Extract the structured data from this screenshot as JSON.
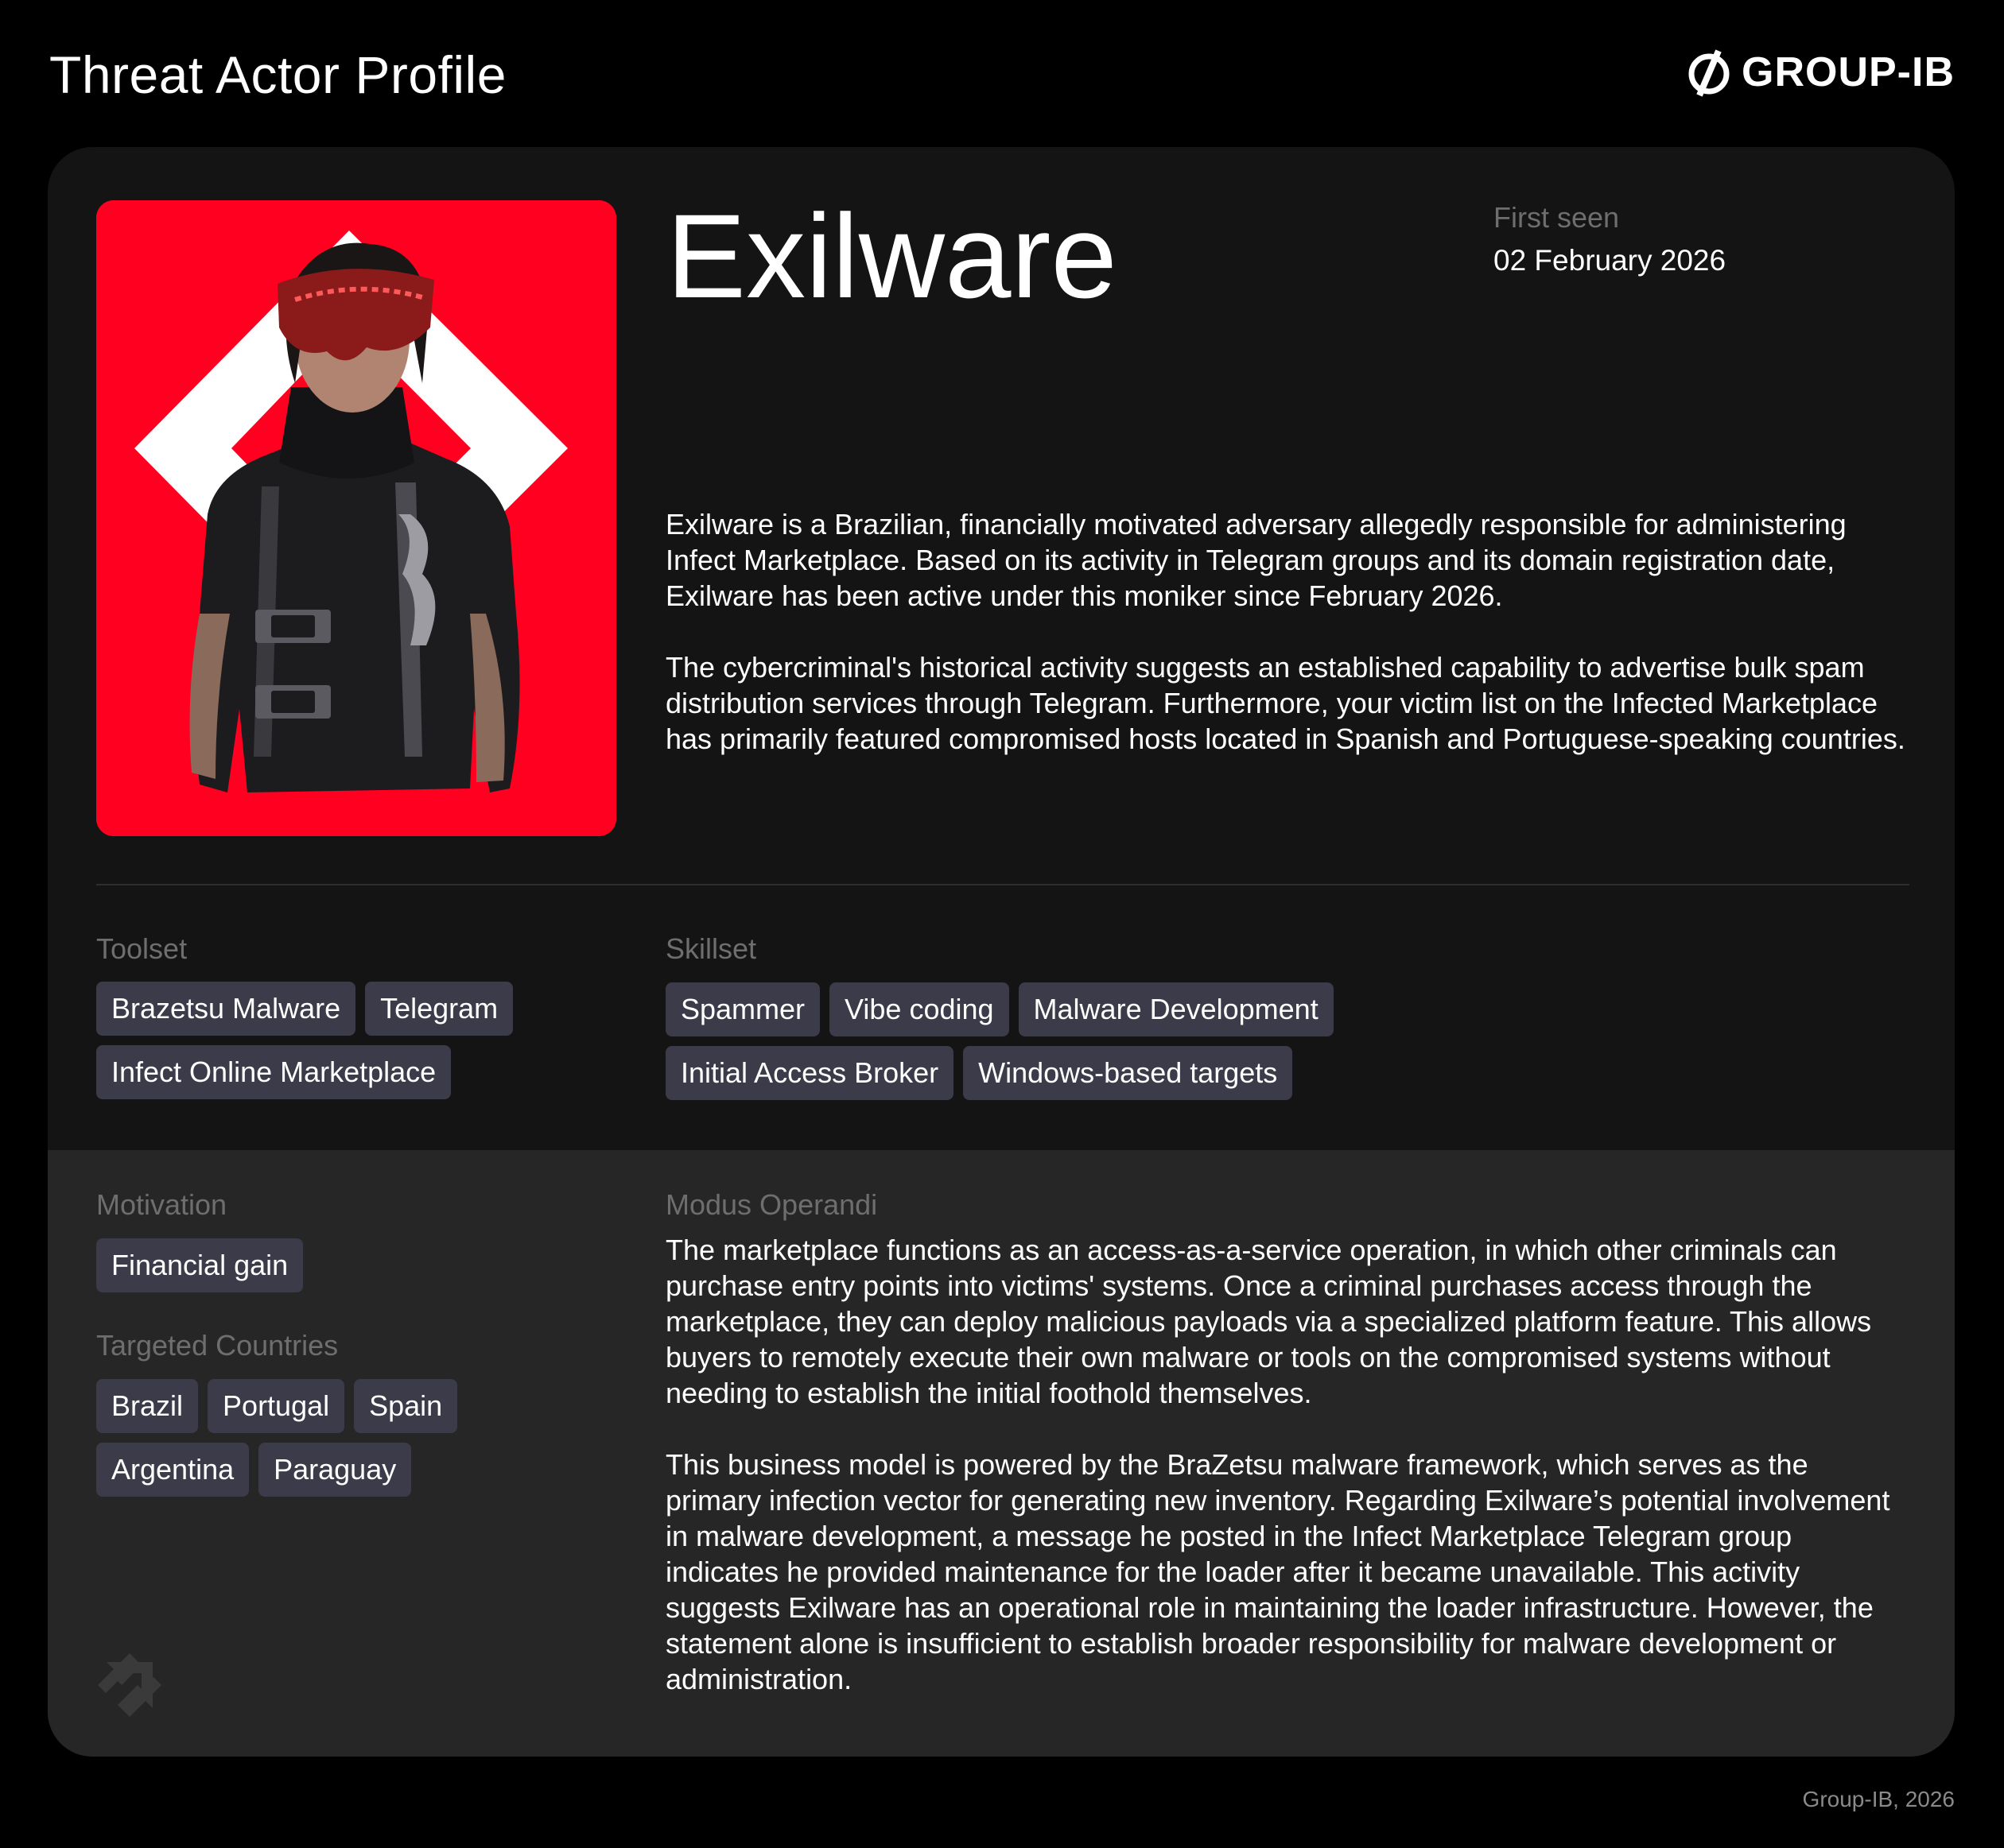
{
  "header": {
    "title": "Threat Actor Profile",
    "brand": "GROUP-IB"
  },
  "profile": {
    "name": "Exilware",
    "first_seen_label": "First seen",
    "first_seen_date": "02 February 2026",
    "description": [
      "Exilware is a Brazilian, financially motivated adversary allegedly responsible for administering Infect Marketplace. Based on its activity in Telegram groups and its domain registration date, Exilware has been active under this moniker since February 2026.",
      "The cybercriminal's historical activity suggests an established capability to advertise bulk spam distribution services through Telegram. Furthermore, your victim list on the Infected Marketplace has primarily featured compromised hosts located in Spanish and Portuguese-speaking countries."
    ]
  },
  "toolset": {
    "label": "Toolset",
    "items": [
      "Brazetsu Malware",
      "Telegram",
      "Infect Online Marketplace"
    ]
  },
  "skillset": {
    "label": "Skillset",
    "items": [
      "Spammer",
      "Vibe coding",
      "Malware Development",
      "Initial Access Broker",
      "Windows-based targets"
    ]
  },
  "motivation": {
    "label": "Motivation",
    "items": [
      "Financial gain"
    ]
  },
  "targeted_countries": {
    "label": "Targeted Countries",
    "items": [
      "Brazil",
      "Portugal",
      "Spain",
      "Argentina",
      "Paraguay"
    ]
  },
  "modus_operandi": {
    "label": "Modus Operandi",
    "paragraphs": [
      "The marketplace functions as an access-as-a-service operation, in which other criminals can purchase entry points into victims' systems. Once a criminal purchases access through the marketplace, they can deploy malicious payloads via a specialized platform feature. This allows buyers to remotely execute their own malware or tools on the compromised systems without needing to establish the initial foothold themselves.",
      "This business model is powered by the BraZetsu malware framework, which serves as the primary infection vector for generating new inventory. Regarding Exilware’s potential involvement in malware development, a message he posted in the Infect Marketplace Telegram group indicates he provided maintenance for the loader after it became unavailable. This activity suggests Exilware has an operational role in maintaining the loader infrastructure. However, the statement alone is insufficient to establish broader responsibility for malware development or administration."
    ]
  },
  "footer": "Group-IB, 2026",
  "colors": {
    "background": "#000000",
    "card_top": "#141414",
    "card_bottom": "#262626",
    "accent_red": "#ff0021",
    "tag_bg": "#3b3b4a",
    "muted_label": "#6e6e6e"
  }
}
